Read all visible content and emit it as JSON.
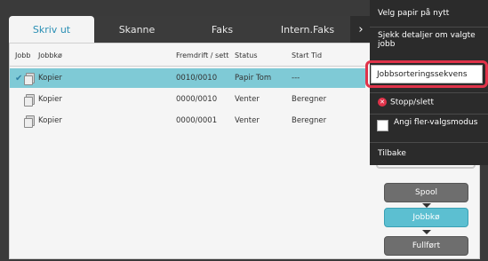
{
  "tabs": [
    {
      "label": "Skriv ut",
      "active": true
    },
    {
      "label": "Skanne",
      "active": false
    },
    {
      "label": "Faks",
      "active": false
    },
    {
      "label": "Intern.Faks",
      "active": false
    }
  ],
  "tab_more_glyph": "›",
  "table": {
    "headers": {
      "jobb": "Jobb",
      "queue": "Jobbkø",
      "progress": "Fremdrift / sett",
      "status": "Status",
      "start": "Start Tid"
    },
    "rows": [
      {
        "selected": true,
        "queue": "Kopier",
        "progress": "0010/0010",
        "status": "Papir Tom",
        "start": "---"
      },
      {
        "selected": false,
        "queue": "Kopier",
        "progress": "0000/0010",
        "status": "Venter",
        "start": "Beregner"
      },
      {
        "selected": false,
        "queue": "Kopier",
        "progress": "0000/0001",
        "status": "Venter",
        "start": "Beregner"
      }
    ]
  },
  "side_buttons": {
    "spool": "Spool",
    "jobbko": "Jobbkø",
    "fullfort": "Fullført"
  },
  "menu": {
    "items": [
      "Velg papir på nytt",
      "Sjekk detaljer om valgte jobb",
      "Jobbsorteringssekvens",
      "Stopp/slett",
      "Angi fler-valgsmodus",
      "Tilbake"
    ],
    "highlighted_index": 2
  },
  "colors": {
    "accent": "#2a8fb4",
    "selected_row": "#7fcad6",
    "highlight_border": "#e0334a",
    "menu_bg": "#2b2b2b"
  }
}
